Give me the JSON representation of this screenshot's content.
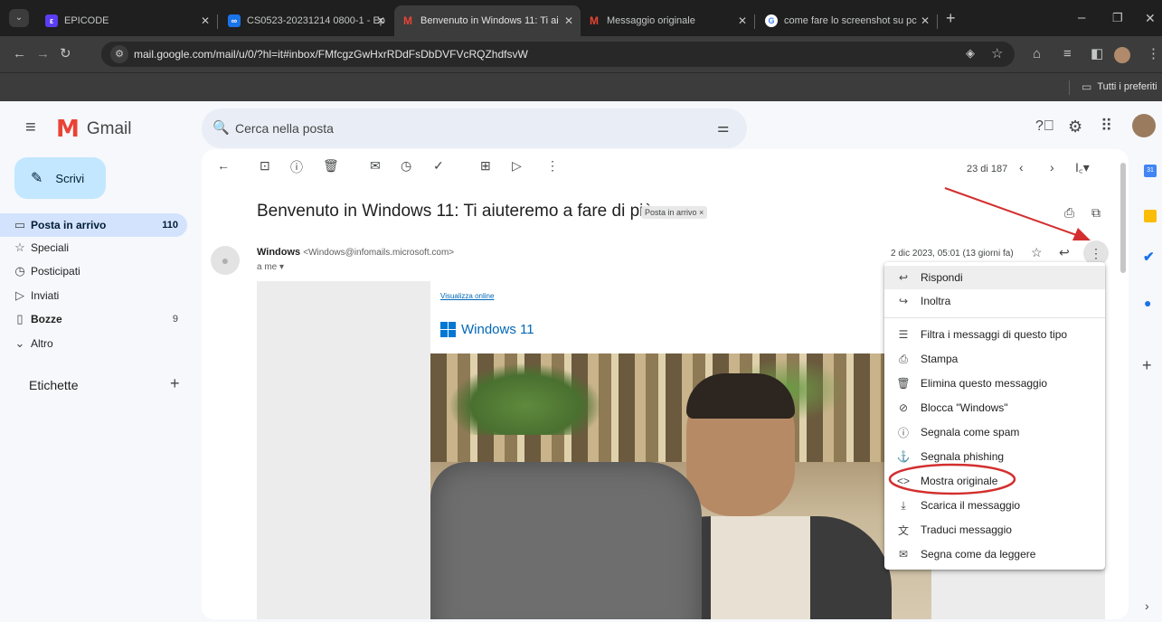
{
  "browser": {
    "tabs": [
      {
        "title": "EPICODE",
        "fav_color": "#5b3df5",
        "fav_text": "Ep"
      },
      {
        "title": "CS0523-20231214 0800-1 - Ep",
        "fav_color": "#4285f4",
        "fav_text": "∞"
      },
      {
        "title": "Benvenuto in Windows 11: Ti ai",
        "fav_color": "#ea4335",
        "fav_text": "M"
      },
      {
        "title": "Messaggio originale",
        "fav_color": "#ea4335",
        "fav_text": "M"
      },
      {
        "title": "come fare lo screenshot su pc",
        "fav_color": "#4285f4",
        "fav_text": "G"
      }
    ],
    "url": "mail.google.com/mail/u/0/?hl=it#inbox/FMfcgzGwHxrRDdFsDbDVFVcRQZhdfsvW",
    "bookmarks_label": "Tutti i preferiti"
  },
  "gmail": {
    "logo": "Gmail",
    "search_placeholder": "Cerca nella posta",
    "compose": "Scrivi",
    "nav": [
      {
        "label": "Posta in arrivo",
        "count": "110",
        "icon": "▭"
      },
      {
        "label": "Speciali",
        "count": "",
        "icon": "☆"
      },
      {
        "label": "Posticipati",
        "count": "",
        "icon": "◷"
      },
      {
        "label": "Inviati",
        "count": "",
        "icon": "▷"
      },
      {
        "label": "Bozze",
        "count": "9",
        "icon": "▯"
      },
      {
        "label": "Altro",
        "count": "",
        "icon": "⌄"
      }
    ],
    "labels_heading": "Etichette",
    "pagination": "23 di 187",
    "subject": "Benvenuto in Windows 11: Ti aiuteremo a fare di più",
    "inbox_chip": "Posta in arrivo ×",
    "sender_name": "Windows",
    "sender_email": "<Windows@infomails.microsoft.com>",
    "to": "a me ▾",
    "date": "2 dic 2023, 05:01 (13 giorni fa)",
    "view_online": "Visualizza online",
    "win_brand": "Windows 11"
  },
  "menu": {
    "items": [
      {
        "label": "Rispondi",
        "icon": "↩"
      },
      {
        "label": "Inoltra",
        "icon": "↪"
      },
      {
        "label": "Filtra i messaggi di questo tipo",
        "icon": "☰"
      },
      {
        "label": "Stampa",
        "icon": "⎙"
      },
      {
        "label": "Elimina questo messaggio",
        "icon": "🗑"
      },
      {
        "label": "Blocca \"Windows\"",
        "icon": "⊘"
      },
      {
        "label": "Segnala come spam",
        "icon": "ⓘ"
      },
      {
        "label": "Segnala phishing",
        "icon": "⚓"
      },
      {
        "label": "Mostra originale",
        "icon": "<>"
      },
      {
        "label": "Scarica il messaggio",
        "icon": "⤓"
      },
      {
        "label": "Traduci messaggio",
        "icon": "文"
      },
      {
        "label": "Segna come da leggere",
        "icon": "✉"
      }
    ]
  },
  "annotation_color": "#d32f2f"
}
